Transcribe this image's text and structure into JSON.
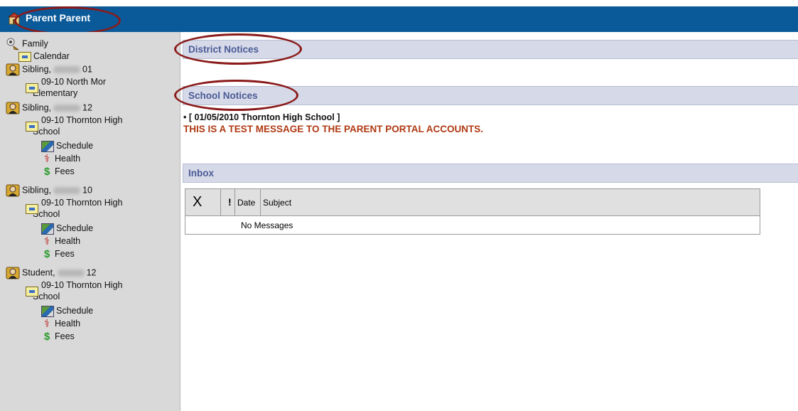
{
  "app": {
    "title": "Parent Parent"
  },
  "sidebar": {
    "family": {
      "label": "Family"
    },
    "calendar": {
      "label": "Calendar"
    },
    "students": [
      {
        "name_prefix": "Sibling,",
        "grade": "01",
        "school_line1": "09-10 North Mor",
        "school_line2": "Elementary",
        "links": []
      },
      {
        "name_prefix": "Sibling,",
        "grade": "12",
        "school_line1": "09-10 Thornton High",
        "school_line2": "School",
        "links": [
          "Schedule",
          "Health",
          "Fees"
        ]
      },
      {
        "name_prefix": "Sibling,",
        "grade": "10",
        "school_line1": "09-10 Thornton High",
        "school_line2": "School",
        "links": [
          "Schedule",
          "Health",
          "Fees"
        ]
      },
      {
        "name_prefix": "Student,",
        "grade": "12",
        "school_line1": "09-10 Thornton High",
        "school_line2": "School",
        "links": [
          "Schedule",
          "Health",
          "Fees"
        ]
      }
    ]
  },
  "main": {
    "district_notices": {
      "title": "District Notices"
    },
    "school_notices": {
      "title": "School Notices",
      "notice_header": "[ 01/05/2010 Thornton High School ]",
      "notice_message": "THIS IS A TEST MESSAGE TO THE PARENT PORTAL ACCOUNTS."
    },
    "inbox": {
      "title": "Inbox",
      "columns": {
        "delete": "X",
        "priority": "!",
        "date": "Date",
        "subject": "Subject"
      },
      "empty_text": "No Messages"
    }
  },
  "colors": {
    "titlebar": "#0a5a9a",
    "section_bar": "#d6dae8",
    "section_text": "#4a5a96",
    "notice_message": "#b03a14",
    "highlight_circle": "#8b1a1a"
  }
}
